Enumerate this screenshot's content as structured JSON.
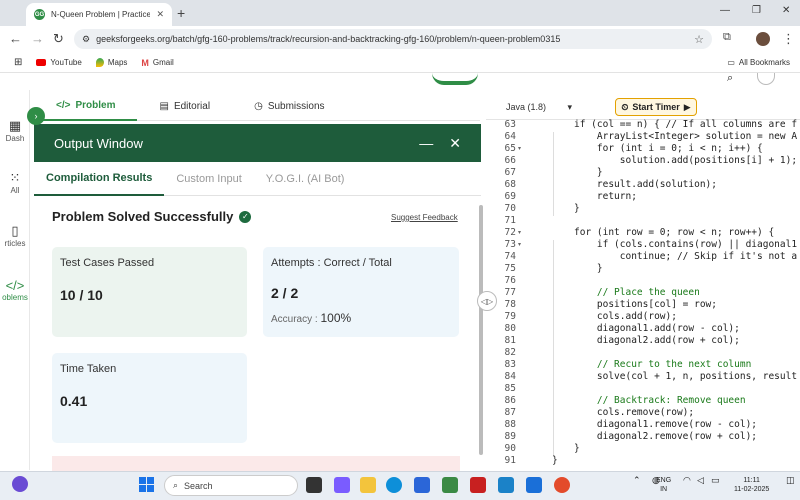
{
  "browser": {
    "tab_title": "N-Queen Problem | Practice | G",
    "url": "geeksforgeeks.org/batch/gfg-160-problems/track/recursion-and-backtracking-gfg-160/problem/n-queen-problem0315",
    "bookmarks": [
      "YouTube",
      "Maps",
      "Gmail"
    ],
    "all_bookmarks": "All Bookmarks"
  },
  "rail": {
    "items": [
      {
        "label": "Dash",
        "icon": "dashboard-icon"
      },
      {
        "label": "All",
        "icon": "grid-icon"
      },
      {
        "label": "rticles",
        "icon": "book-icon"
      },
      {
        "label": "oblems",
        "icon": "code-icon"
      }
    ]
  },
  "problem_tabs": [
    "Problem",
    "Editorial",
    "Submissions"
  ],
  "output": {
    "title": "Output Window",
    "tabs": [
      "Compilation Results",
      "Custom Input",
      "Y.O.G.I. (AI Bot)"
    ],
    "status": "Problem Solved Successfully",
    "feedback": "Suggest Feedback",
    "test_cases_label": "Test Cases Passed",
    "test_cases_value": "10 / 10",
    "attempts_label": "Attempts : Correct / Total",
    "attempts_value": "2 / 2",
    "accuracy_label": "Accuracy :",
    "accuracy_value": "100%",
    "time_label": "Time Taken",
    "time_value": "0.41"
  },
  "editor": {
    "language": "Java (1.8)",
    "timer": "Start Timer"
  },
  "code_lines": [
    {
      "n": "63",
      "text": "if (col == n) { // If all columns are f"
    },
    {
      "n": "64",
      "text": "    ArrayList<Integer> solution = new A"
    },
    {
      "n": "65",
      "text": "    for (int i = 0; i < n; i++) {"
    },
    {
      "n": "66",
      "text": "        solution.add(positions[i] + 1);"
    },
    {
      "n": "67",
      "text": "    }"
    },
    {
      "n": "68",
      "text": "    result.add(solution);"
    },
    {
      "n": "69",
      "text": "    return;"
    },
    {
      "n": "70",
      "text": "}"
    },
    {
      "n": "71",
      "text": ""
    },
    {
      "n": "72",
      "text": "for (int row = 0; row < n; row++) {"
    },
    {
      "n": "73",
      "text": "    if (cols.contains(row) || diagonal1"
    },
    {
      "n": "74",
      "text": "        continue; // Skip if it's not a"
    },
    {
      "n": "75",
      "text": "    }"
    },
    {
      "n": "76",
      "text": ""
    },
    {
      "n": "77",
      "text": "    // Place the queen"
    },
    {
      "n": "78",
      "text": "    positions[col] = row;"
    },
    {
      "n": "79",
      "text": "    cols.add(row);"
    },
    {
      "n": "80",
      "text": "    diagonal1.add(row - col);"
    },
    {
      "n": "81",
      "text": "    diagonal2.add(row + col);"
    },
    {
      "n": "82",
      "text": ""
    },
    {
      "n": "83",
      "text": "    // Recur to the next column"
    },
    {
      "n": "84",
      "text": "    solve(col + 1, n, positions, result"
    },
    {
      "n": "85",
      "text": ""
    },
    {
      "n": "86",
      "text": "    // Backtrack: Remove queen"
    },
    {
      "n": "87",
      "text": "    cols.remove(row);"
    },
    {
      "n": "88",
      "text": "    diagonal1.remove(row - col);"
    },
    {
      "n": "89",
      "text": "    diagonal2.remove(row + col);"
    },
    {
      "n": "90",
      "text": "}"
    },
    {
      "n": "91",
      "text": "}"
    }
  ],
  "taskbar": {
    "search": "Search",
    "lang": "ENG",
    "region": "IN",
    "time": "11:11",
    "date": "11-02-2025"
  }
}
